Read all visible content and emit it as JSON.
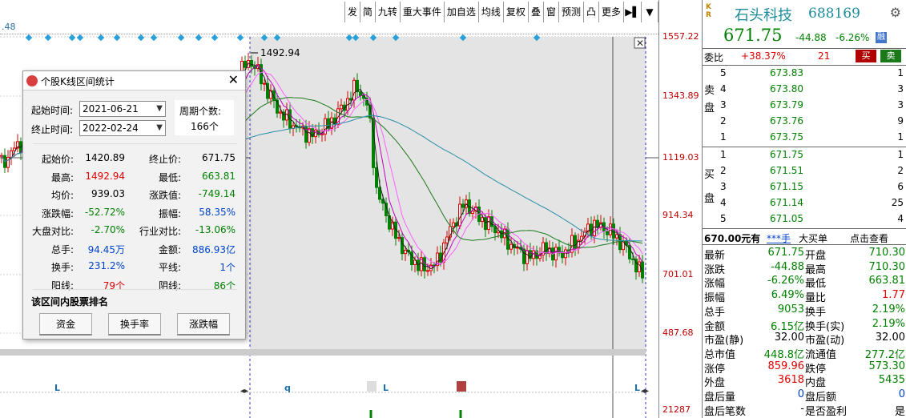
{
  "toolbar": {
    "items": [
      "发",
      "简",
      "九转",
      "重大事件",
      "加自选",
      "均线",
      "复权",
      "叠",
      "窗",
      "预测",
      "凸",
      "更多",
      "▶▌",
      "▼"
    ]
  },
  "chart": {
    "corner_value": ".48",
    "peak_label": "1492.94",
    "bottom_markers": [
      "L",
      "q",
      "L",
      "L"
    ],
    "colors": {
      "up": "#e00000",
      "down": "#008000",
      "ma5": "#222222",
      "ma10": "#c000c0",
      "ma20": "#ff60ff",
      "ma60": "#1a7a1a",
      "ma120": "#2a8fa8"
    }
  },
  "price_axis": {
    "labels": [
      "1557.22",
      "1343.89",
      "1119.03",
      "914.34",
      "701.01",
      "487.68",
      "21287"
    ]
  },
  "quote": {
    "kr": [
      "K",
      "R"
    ],
    "name": "石头科技",
    "code": "688169",
    "price": "671.75",
    "change": "-44.88",
    "change_pct": "-6.26%",
    "rong_label": "融",
    "weibi_label": "委比",
    "weibi_value": "+38.37%",
    "weicha_value": "21",
    "buy_btn": "买",
    "sell_btn": "卖",
    "sell_side_label": [
      "卖",
      "盘"
    ],
    "buy_side_label": [
      "买",
      "盘"
    ],
    "asks": [
      {
        "level": "5",
        "price": "673.83",
        "vol": "1"
      },
      {
        "level": "4",
        "price": "673.80",
        "vol": "3"
      },
      {
        "level": "3",
        "price": "673.79",
        "vol": "3"
      },
      {
        "level": "2",
        "price": "673.76",
        "vol": "9"
      },
      {
        "level": "1",
        "price": "673.75",
        "vol": "1"
      }
    ],
    "bids": [
      {
        "level": "1",
        "price": "671.75",
        "vol": "1"
      },
      {
        "level": "2",
        "price": "671.51",
        "vol": "2"
      },
      {
        "level": "3",
        "price": "671.15",
        "vol": "6"
      },
      {
        "level": "4",
        "price": "671.14",
        "vol": "25"
      },
      {
        "level": "5",
        "price": "671.05",
        "vol": "4"
      }
    ],
    "bigorder_bar": {
      "price": "670.00元有",
      "holder": "***手",
      "big_buy": "大买单",
      "view": "点击查看"
    },
    "stats": [
      {
        "l1": "最新",
        "v1": "671.75",
        "c1": "green",
        "l2": "开盘",
        "v2": "710.30",
        "c2": "green"
      },
      {
        "l1": "涨跌",
        "v1": "-44.88",
        "c1": "green",
        "l2": "最高",
        "v2": "710.30",
        "c2": "green"
      },
      {
        "l1": "涨幅",
        "v1": "-6.26%",
        "c1": "green",
        "l2": "最低",
        "v2": "663.81",
        "c2": "green"
      },
      {
        "l1": "振幅",
        "v1": "6.49%",
        "c1": "green",
        "l2": "量比",
        "v2": "1.77",
        "c2": "red"
      },
      {
        "l1": "总手",
        "v1": "9053",
        "c1": "green",
        "l2": "换手",
        "v2": "2.19%",
        "c2": "green"
      },
      {
        "l1": "金额",
        "v1": "6.15亿",
        "c1": "green",
        "l2": "换手(实)",
        "v2": "2.19%",
        "c2": "green"
      },
      {
        "l1": "市盈(静)",
        "v1": "32.00",
        "c1": "blk",
        "l2": "市盈(动)",
        "v2": "32.00",
        "c2": "blk"
      },
      {
        "l1": "总市值",
        "v1": "448.8亿",
        "c1": "green",
        "l2": "流通值",
        "v2": "277.2亿",
        "c2": "green"
      },
      {
        "l1": "涨停",
        "v1": "859.96",
        "c1": "red",
        "l2": "跌停",
        "v2": "573.30",
        "c2": "green"
      },
      {
        "l1": "外盘",
        "v1": "3618",
        "c1": "red",
        "l2": "内盘",
        "v2": "5435",
        "c2": "green"
      },
      {
        "l1": "盘后量",
        "v1": "0",
        "c1": "blue",
        "l2": "盘后额",
        "v2": "0",
        "c2": "blue"
      },
      {
        "l1": "盘后笔数",
        "v1": "-",
        "c1": "blk",
        "l2": "是否盈利",
        "v2": "是",
        "c2": "blk"
      }
    ]
  },
  "dialog": {
    "title": "个股K线区间统计",
    "start_label": "起始时间:",
    "start_value": "2021-06-21",
    "end_label": "终止时间:",
    "end_value": "2022-02-24",
    "period_label": "周期个数:",
    "period_value": "166个",
    "stats": [
      {
        "l1": "起始价:",
        "v1": "1420.89",
        "c1": "blk",
        "l2": "终止价:",
        "v2": "671.75",
        "c2": "blk"
      },
      {
        "l1": "最高:",
        "v1": "1492.94",
        "c1": "red",
        "l2": "最低:",
        "v2": "663.81",
        "c2": "green"
      },
      {
        "l1": "均价:",
        "v1": "939.03",
        "c1": "blk",
        "l2": "涨跌值:",
        "v2": "-749.14",
        "c2": "green"
      },
      {
        "l1": "涨跌幅:",
        "v1": "-52.72%",
        "c1": "green",
        "l2": "振幅:",
        "v2": "58.35%",
        "c2": "blue"
      },
      {
        "l1": "大盘对比:",
        "v1": "-2.70%",
        "c1": "green",
        "l2": "行业对比:",
        "v2": "-13.06%",
        "c2": "green"
      },
      {
        "l1": "总手:",
        "v1": "94.45万",
        "c1": "blue",
        "l2": "金额:",
        "v2": "886.93亿",
        "c2": "blue"
      },
      {
        "l1": "换手:",
        "v1": "231.2%",
        "c1": "blue",
        "l2": "平线:",
        "v2": "1个",
        "c2": "blue"
      },
      {
        "l1": "阳线:",
        "v1": "79个",
        "c1": "red",
        "l2": "阴线:",
        "v2": "86个",
        "c2": "green"
      }
    ],
    "rank_label": "该区间内股票排名",
    "buttons": [
      "资金",
      "换手率",
      "涨跌幅"
    ]
  }
}
